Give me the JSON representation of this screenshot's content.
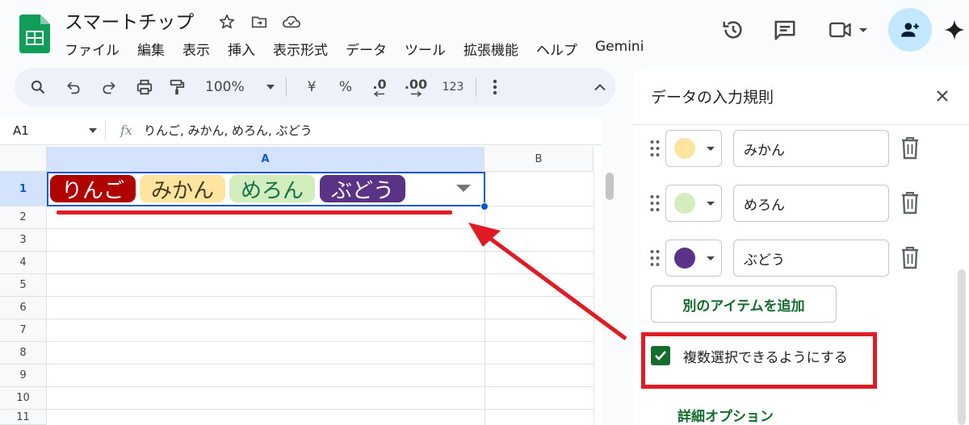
{
  "app": {
    "doc_title": "スマートチップ",
    "menu": [
      "ファイル",
      "編集",
      "表示",
      "挿入",
      "表示形式",
      "データ",
      "ツール",
      "拡張機能",
      "ヘルプ",
      "Gemini"
    ]
  },
  "toolbar": {
    "zoom": "100%",
    "currency": "¥",
    "percent": "%",
    "dec_decrease": ".0",
    "dec_increase": ".00",
    "number_format": "123"
  },
  "formula_bar": {
    "name_box": "A1",
    "fx_label": "fx",
    "value": "りんご, みかん, めろん, ぶどう"
  },
  "grid": {
    "columns": [
      "A",
      "B"
    ],
    "rows": [
      "1",
      "2",
      "3",
      "4",
      "5",
      "6",
      "7",
      "8",
      "9",
      "10",
      "11"
    ],
    "cell_a1_chips": [
      {
        "label": "りんご",
        "bg": "#b10202",
        "fg": "#ffffff"
      },
      {
        "label": "みかん",
        "bg": "#ffe5a0",
        "fg": "#473821"
      },
      {
        "label": "めろん",
        "bg": "#d4edbc",
        "fg": "#11734b"
      },
      {
        "label": "ぶどう",
        "bg": "#5a3286",
        "fg": "#ffffff"
      }
    ]
  },
  "panel": {
    "title": "データの入力規則",
    "items": [
      {
        "value": "みかん",
        "color": "#ffe5a0"
      },
      {
        "value": "めろん",
        "color": "#d4edbc"
      },
      {
        "value": "ぶどう",
        "color": "#5a3286"
      }
    ],
    "add_item_label": "別のアイテムを追加",
    "multi_select_label": "複数選択できるようにする",
    "multi_select_checked": true,
    "advanced_options_label": "詳細オプション"
  },
  "colors": {
    "accent_blue": "#0b57d0",
    "annotation_red": "#e01b24",
    "panel_green": "#146c2e"
  }
}
